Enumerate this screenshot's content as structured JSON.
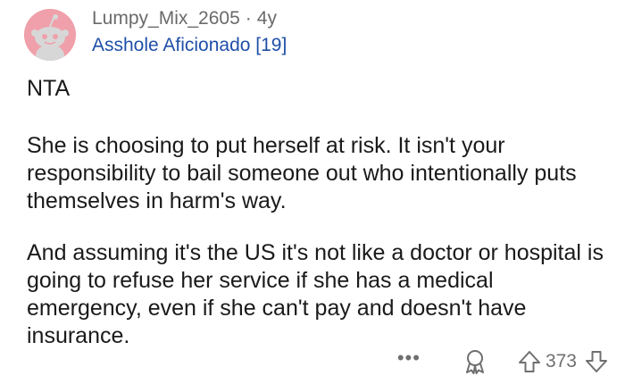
{
  "comment": {
    "author": "Lumpy_Mix_2605",
    "separator": "·",
    "age": "4y",
    "flair": "Asshole Aficionado [19]",
    "verdict": "NTA",
    "paragraphs": [
      "She is choosing to put herself at risk. It isn't your responsibility to bail someone out who intentionally puts themselves in harm's way.",
      "And assuming it's the US it's not like a doctor or hospital is going to refuse her service if she has a medical emergency, even if she can't pay and doesn't have insurance."
    ]
  },
  "actions": {
    "more_label": "•••",
    "score": "373"
  },
  "colors": {
    "avatar_bg": "#f0a0aa",
    "flair_text": "#1f4fa8",
    "meta_text": "#6a6a6a"
  },
  "icons": [
    "snoo-avatar-icon",
    "award-icon",
    "upvote-arrow-icon",
    "downvote-arrow-icon"
  ]
}
